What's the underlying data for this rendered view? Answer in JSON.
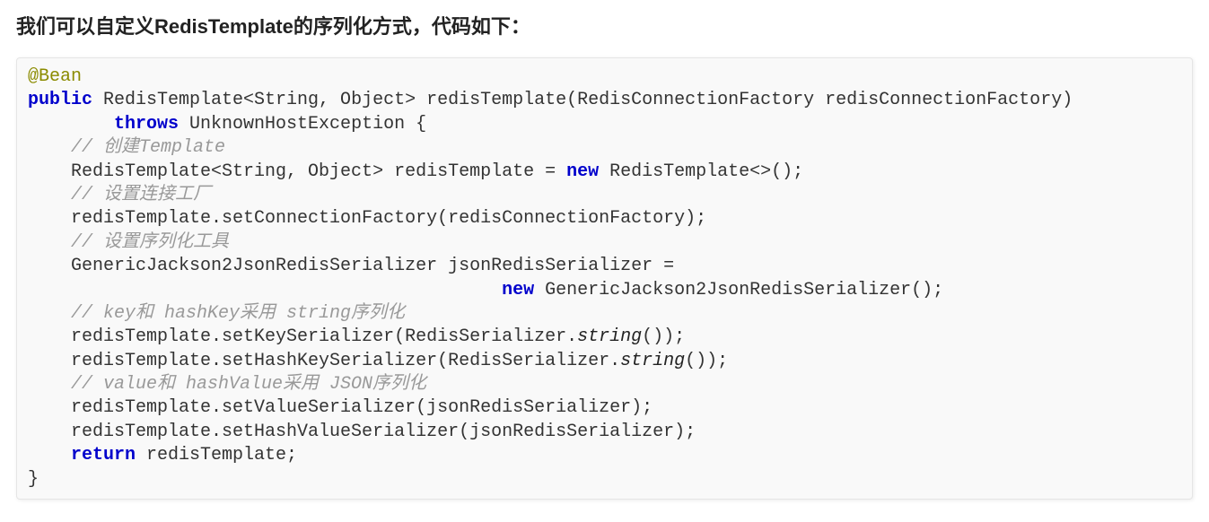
{
  "intro": "我们可以自定义RedisTemplate的序列化方式，代码如下：",
  "code": {
    "line1_annotation": "@Bean",
    "line2_keyword1": "public",
    "line2_text1": " RedisTemplate<String, Object> redisTemplate(RedisConnectionFactory redisConnectionFactory)",
    "line3_indent": "        ",
    "line3_keyword": "throws",
    "line3_text": " UnknownHostException {",
    "line4_comment": "    // 创建Template",
    "line5_text1": "    RedisTemplate<String, Object> redisTemplate = ",
    "line5_keyword": "new",
    "line5_text2": " RedisTemplate<>();",
    "line6_comment": "    // 设置连接工厂",
    "line7_text": "    redisTemplate.setConnectionFactory(redisConnectionFactory);",
    "line8_comment": "    // 设置序列化工具",
    "line9_text": "    GenericJackson2JsonRedisSerializer jsonRedisSerializer = ",
    "line10_indent": "                                            ",
    "line10_keyword": "new",
    "line10_text": " GenericJackson2JsonRedisSerializer();",
    "line11_comment": "    // key和 hashKey采用 string序列化",
    "line12_text1": "    redisTemplate.setKeySerializer(RedisSerializer.",
    "line12_method": "string",
    "line12_text2": "());",
    "line13_text1": "    redisTemplate.setHashKeySerializer(RedisSerializer.",
    "line13_method": "string",
    "line13_text2": "());",
    "line14_comment": "    // value和 hashValue采用 JSON序列化",
    "line15_text": "    redisTemplate.setValueSerializer(jsonRedisSerializer);",
    "line16_text": "    redisTemplate.setHashValueSerializer(jsonRedisSerializer);",
    "line17_indent": "    ",
    "line17_keyword": "return",
    "line17_text": " redisTemplate;",
    "line18_text": "}"
  }
}
